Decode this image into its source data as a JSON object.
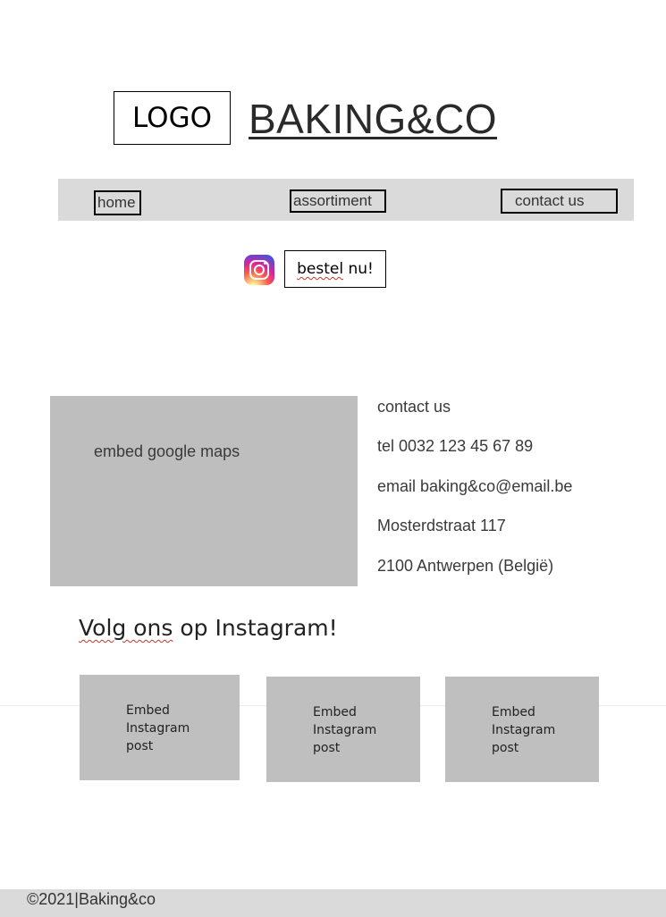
{
  "header": {
    "logo_label": "LOGO",
    "brand_name": "BAKING&CO"
  },
  "nav": {
    "items": [
      {
        "label": "home"
      },
      {
        "label": "assortiment"
      },
      {
        "label": "contact us"
      }
    ]
  },
  "actions": {
    "instagram_icon": "instagram-icon",
    "order_word": "bestel",
    "order_rest": " nu!"
  },
  "map": {
    "label": "embed google maps"
  },
  "contact": {
    "lines": [
      "contact us",
      "tel 0032 123 45 67 89",
      "email baking&co@email.be",
      "Mosterdstraat 117",
      "2100 Antwerpen (België)"
    ]
  },
  "instagram": {
    "title_word": "Volg ons",
    "title_rest": " op Instagram!",
    "posts": [
      {
        "line1": "Embed",
        "line2": "Instagram",
        "line3": "post"
      },
      {
        "line1": "Embed",
        "line2": "Instagram",
        "line3": "post"
      },
      {
        "line1": "Embed",
        "line2": "Instagram",
        "line3": "post"
      }
    ]
  },
  "footer": {
    "text": "©2021|Baking&co"
  },
  "colors": {
    "nav_bg": "#dadada",
    "placeholder_bg": "#bebebe",
    "spell_underline": "#c0392b"
  }
}
